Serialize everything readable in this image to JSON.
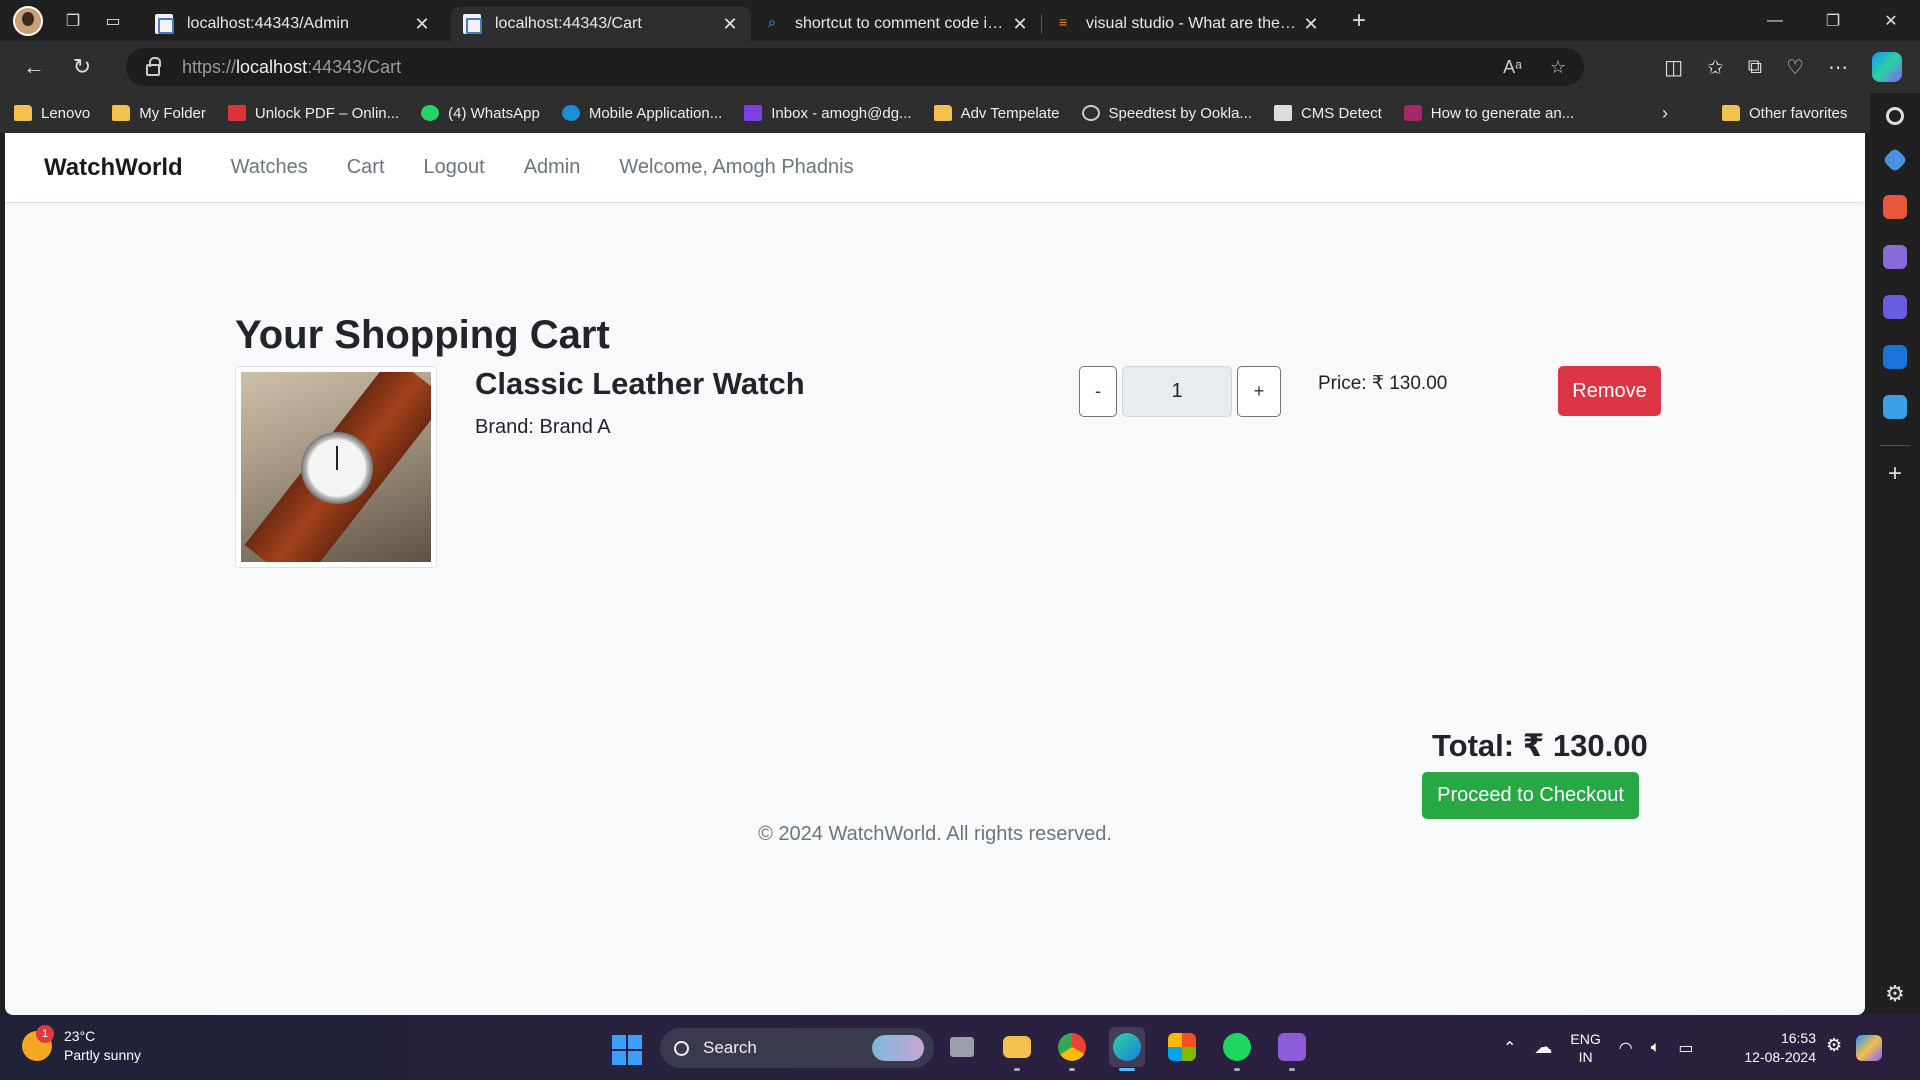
{
  "browser": {
    "tabs": [
      {
        "title": "localhost:44343/Admin",
        "active": false,
        "icon": "page-icon"
      },
      {
        "title": "localhost:44343/Cart",
        "active": true,
        "icon": "page-icon"
      },
      {
        "title": "shortcut to comment code in visu",
        "active": false,
        "icon": "search-icon"
      },
      {
        "title": "visual studio - What are the key s",
        "active": false,
        "icon": "stackoverflow-icon"
      }
    ],
    "url_scheme": "https://",
    "url_host": "localhost",
    "url_rest": ":44343/Cart",
    "favorites": [
      {
        "label": "Lenovo",
        "icon": "folder-icon"
      },
      {
        "label": "My Folder",
        "icon": "folder-icon"
      },
      {
        "label": "Unlock PDF – Onlin...",
        "icon": "pdf-icon"
      },
      {
        "label": "(4) WhatsApp",
        "icon": "whatsapp-icon"
      },
      {
        "label": "Mobile Application...",
        "icon": "app-icon"
      },
      {
        "label": "Inbox - amogh@dg...",
        "icon": "mail-icon"
      },
      {
        "label": "Adv Tempelate",
        "icon": "folder-icon"
      },
      {
        "label": "Speedtest by Ookla...",
        "icon": "speedtest-icon"
      },
      {
        "label": "CMS Detect",
        "icon": "cms-icon"
      },
      {
        "label": "How to generate an...",
        "icon": "yoast-icon"
      }
    ],
    "other_favorites": "Other favorites"
  },
  "site": {
    "brand": "WatchWorld",
    "nav": [
      "Watches",
      "Cart",
      "Logout",
      "Admin"
    ],
    "welcome": "Welcome, Amogh Phadnis"
  },
  "cart": {
    "title": "Your Shopping Cart",
    "items": [
      {
        "name": "Classic Leather Watch",
        "brand_text": "Brand: Brand A",
        "quantity": "1",
        "minus_label": "-",
        "plus_label": "+",
        "price_text": "Price: ₹ 130.00",
        "remove_label": "Remove"
      }
    ],
    "total_text": "Total: ₹ 130.00",
    "checkout_label": "Proceed to Checkout"
  },
  "footer": {
    "text": "© 2024 WatchWorld. All rights reserved."
  },
  "taskbar": {
    "weather_temp": "23°C",
    "weather_desc": "Partly sunny",
    "weather_badge": "1",
    "search_label": "Search",
    "lang_top": "ENG",
    "lang_bottom": "IN",
    "time": "16:53",
    "date": "12-08-2024"
  },
  "colors": {
    "danger": "#dc3545",
    "success": "#28a745",
    "page_bg": "#f8f9fa"
  }
}
